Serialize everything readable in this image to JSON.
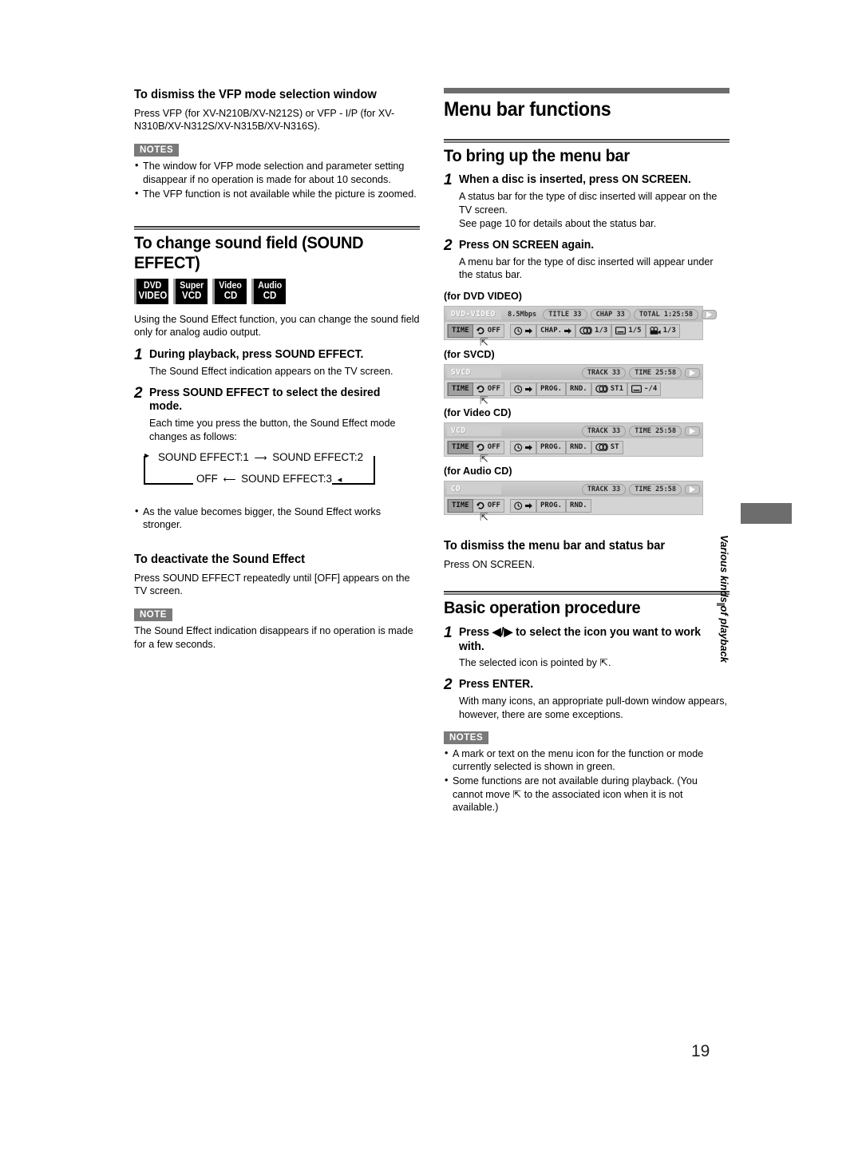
{
  "page": {
    "number": "19",
    "side_tab": "Various kinds of playback"
  },
  "left_column": {
    "vfp": {
      "heading": "To dismiss the VFP mode selection window",
      "body": "Press VFP (for XV-N210B/XV-N212S) or VFP - I/P (for XV-N310B/XV-N312S/XV-N315B/XV-N316S).",
      "notes_tag": "NOTES",
      "notes": [
        "The window for VFP mode selection and parameter setting disappear if no operation is made for about 10 seconds.",
        "The VFP function is not available while the picture is zoomed."
      ]
    },
    "sound_effect": {
      "heading": "To change sound field (SOUND EFFECT)",
      "discs": [
        {
          "line1": "DVD",
          "line2": "VIDEO"
        },
        {
          "line1": "Super",
          "line2": "VCD"
        },
        {
          "line1": "Video",
          "line2": "CD"
        },
        {
          "line1": "Audio",
          "line2": "CD"
        }
      ],
      "intro": "Using the Sound Effect function, you can change the sound field only for analog audio output.",
      "step1_num": "1",
      "step1_title": "During playback, press SOUND EFFECT.",
      "step1_body": "The Sound Effect indication appears on the TV screen.",
      "step2_num": "2",
      "step2_title": "Press SOUND EFFECT to select the desired mode.",
      "step2_body": "Each time you press the button, the Sound Effect mode changes as follows:",
      "cycle": {
        "item1": "SOUND EFFECT:1",
        "item2": "SOUND EFFECT:2",
        "item3": "SOUND EFFECT:3",
        "item4": "OFF"
      },
      "bullet": "As the value becomes bigger, the Sound Effect works stronger."
    },
    "deactivate": {
      "heading": "To deactivate the Sound Effect",
      "body": "Press SOUND EFFECT repeatedly until [OFF] appears on the TV screen.",
      "note_tag": "NOTE",
      "note_body": "The Sound Effect indication disappears if no operation is made for a few seconds."
    }
  },
  "right_column": {
    "section_title": "Menu bar functions",
    "bring_up": {
      "heading": "To bring up the menu bar",
      "step1_num": "1",
      "step1_title": "When a disc is inserted, press ON SCREEN.",
      "step1_body": "A status bar for the type of disc inserted will appear on the TV screen.\nSee page 10 for details about the status bar.",
      "step2_num": "2",
      "step2_title": "Press ON SCREEN again.",
      "step2_body": "A menu bar for the type of disc inserted will appear under the status bar."
    },
    "osd": {
      "dvd": {
        "label": "(for DVD VIDEO)",
        "disc_type": "DVD-VIDEO",
        "bitrate": "8.5Mbps",
        "pills": [
          "TITLE 33",
          "CHAP 33",
          "TOTAL 1:25:58"
        ],
        "menu": [
          {
            "icon": "time-text",
            "label": "TIME",
            "selected": true
          },
          {
            "icon": "repeat-icon",
            "label": "OFF"
          },
          {
            "icon": "clock-arrow-icon",
            "label": ""
          },
          {
            "icon": "chapter-arrow-icon",
            "label": "CHAP."
          },
          {
            "icon": "audio-icon",
            "label": "1/3"
          },
          {
            "icon": "subtitle-icon",
            "label": "1/5"
          },
          {
            "icon": "angle-camera-icon",
            "label": "1/3"
          }
        ]
      },
      "svcd": {
        "label": "(for SVCD)",
        "disc_type": "SVCD",
        "bitrate": "",
        "pills": [
          "TRACK 33",
          "TIME    25:58"
        ],
        "menu": [
          {
            "icon": "time-text",
            "label": "TIME",
            "selected": true
          },
          {
            "icon": "repeat-icon",
            "label": "OFF"
          },
          {
            "icon": "clock-arrow-icon",
            "label": ""
          },
          {
            "icon": "prog-text",
            "label": "PROG."
          },
          {
            "icon": "rnd-text",
            "label": "RND."
          },
          {
            "icon": "audio-icon",
            "label": "ST1"
          },
          {
            "icon": "subtitle-icon",
            "label": "-/4"
          }
        ]
      },
      "vcd": {
        "label": "(for Video CD)",
        "disc_type": "VCD",
        "bitrate": "",
        "pills": [
          "TRACK 33",
          "TIME    25:58"
        ],
        "menu": [
          {
            "icon": "time-text",
            "label": "TIME",
            "selected": true
          },
          {
            "icon": "repeat-icon",
            "label": "OFF"
          },
          {
            "icon": "clock-arrow-icon",
            "label": ""
          },
          {
            "icon": "prog-text",
            "label": "PROG."
          },
          {
            "icon": "rnd-text",
            "label": "RND."
          },
          {
            "icon": "audio-icon",
            "label": "ST"
          }
        ]
      },
      "cd": {
        "label": "(for Audio CD)",
        "disc_type": "CD",
        "bitrate": "",
        "pills": [
          "TRACK 33",
          "TIME    25:58"
        ],
        "menu": [
          {
            "icon": "time-text",
            "label": "TIME",
            "selected": true
          },
          {
            "icon": "repeat-icon",
            "label": "OFF"
          },
          {
            "icon": "clock-arrow-icon",
            "label": ""
          },
          {
            "icon": "prog-text",
            "label": "PROG."
          },
          {
            "icon": "rnd-text",
            "label": "RND."
          }
        ]
      }
    },
    "dismiss": {
      "heading": "To dismiss the menu bar and status bar",
      "body": "Press ON SCREEN."
    },
    "basic": {
      "heading": "Basic operation procedure",
      "step1_num": "1",
      "step1_title_pre": "Press ",
      "step1_title_keys": "◀/▶",
      "step1_title_post": " to select the icon you want to work with.",
      "step1_body_pre": "The selected icon is pointed by ",
      "step1_body_post": ".",
      "step2_num": "2",
      "step2_title": "Press ENTER.",
      "step2_body": "With many icons, an appropriate pull-down window appears, however, there are some exceptions.",
      "notes_tag": "NOTES",
      "note1": "A mark or text on the menu icon for the function or mode currently selected is shown in green.",
      "note2_pre": "Some functions are not available during playback. (You cannot move ",
      "note2_post": " to the associated icon when it is not available.)"
    }
  },
  "colors": {
    "rule": "#6d6d6d",
    "tag_bg": "#7a7a7a",
    "osd_bg": "#d4d4d4",
    "osd_sel": "#9f9f9f"
  }
}
